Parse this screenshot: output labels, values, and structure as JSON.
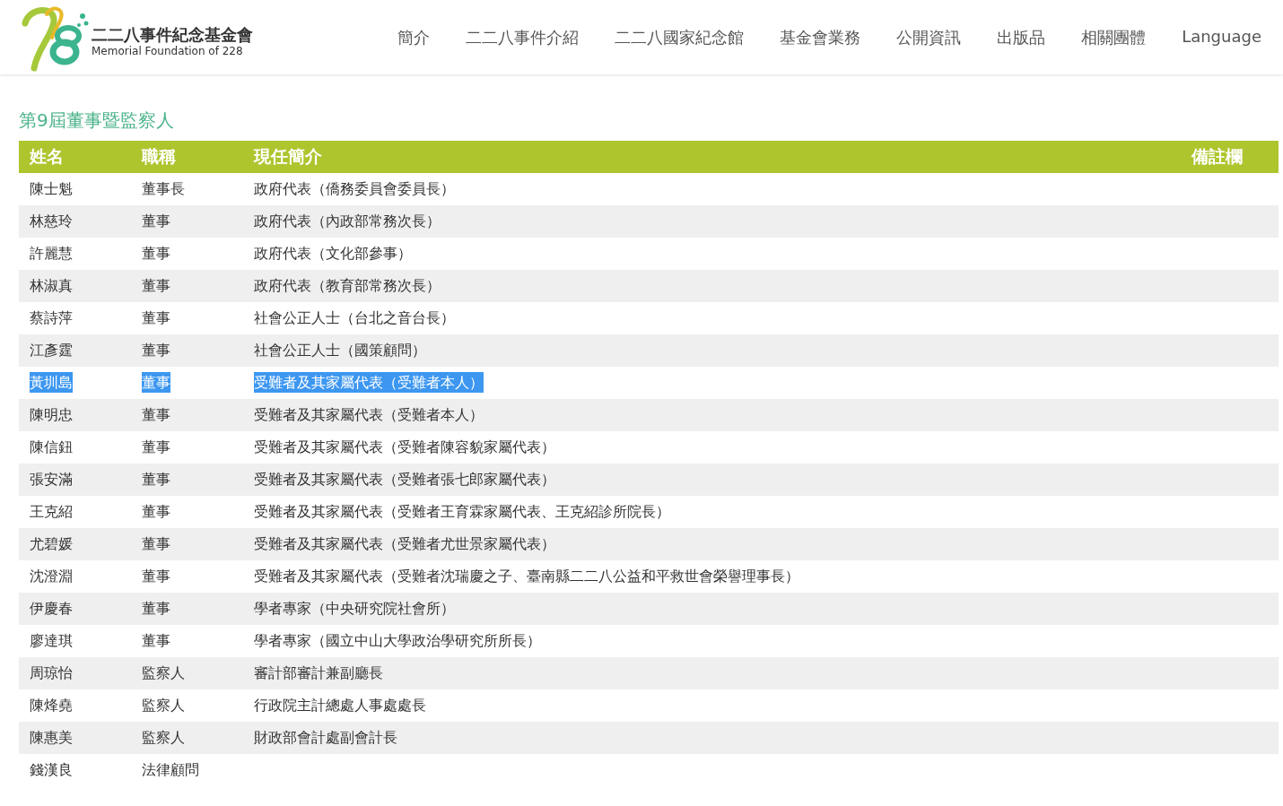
{
  "logo": {
    "title": "二二八事件紀念基金會",
    "subtitle": "Memorial Foundation of 228"
  },
  "nav": [
    "簡介",
    "二二八事件介紹",
    "二二八國家紀念館",
    "基金會業務",
    "公開資訊",
    "出版品",
    "相關團體",
    "Language"
  ],
  "page_title": "第9屆董事暨監察人",
  "table": {
    "columns": [
      "姓名",
      "職稱",
      "現任簡介",
      "備註欄"
    ],
    "rows": [
      {
        "name": "陳士魁",
        "title": "董事長",
        "bio": "政府代表（僑務委員會委員長）",
        "selected": false
      },
      {
        "name": "林慈玲",
        "title": "董事",
        "bio": "政府代表（內政部常務次長）",
        "selected": false
      },
      {
        "name": "許麗慧",
        "title": "董事",
        "bio": "政府代表（文化部參事）",
        "selected": false
      },
      {
        "name": "林淑真",
        "title": "董事",
        "bio": "政府代表（教育部常務次長）",
        "selected": false
      },
      {
        "name": "蔡詩萍",
        "title": "董事",
        "bio": "社會公正人士（台北之音台長）",
        "selected": false
      },
      {
        "name": "江彥霆",
        "title": "董事",
        "bio": "社會公正人士（國策顧問）",
        "selected": false
      },
      {
        "name": "黃圳島",
        "title": "董事",
        "bio": "受難者及其家屬代表（受難者本人）",
        "selected": true
      },
      {
        "name": "陳明忠",
        "title": "董事",
        "bio": "受難者及其家屬代表（受難者本人）",
        "selected": false
      },
      {
        "name": "陳信鈕",
        "title": "董事",
        "bio": "受難者及其家屬代表（受難者陳容貌家屬代表）",
        "selected": false
      },
      {
        "name": "張安滿",
        "title": "董事",
        "bio": "受難者及其家屬代表（受難者張七郎家屬代表）",
        "selected": false
      },
      {
        "name": "王克紹",
        "title": "董事",
        "bio": "受難者及其家屬代表（受難者王育霖家屬代表、王克紹診所院長）",
        "selected": false
      },
      {
        "name": "尤碧媛",
        "title": "董事",
        "bio": "受難者及其家屬代表（受難者尤世景家屬代表）",
        "selected": false
      },
      {
        "name": "沈澄淵",
        "title": "董事",
        "bio": "受難者及其家屬代表（受難者沈瑞慶之子、臺南縣二二八公益和平救世會榮譽理事長）",
        "selected": false
      },
      {
        "name": "伊慶春",
        "title": "董事",
        "bio": "學者專家（中央研究院社會所）",
        "selected": false
      },
      {
        "name": "廖達琪",
        "title": "董事",
        "bio": "學者專家（國立中山大學政治學研究所所長）",
        "selected": false
      },
      {
        "name": "周琼怡",
        "title": "監察人",
        "bio": "審計部審計兼副廳長",
        "selected": false
      },
      {
        "name": "陳烽堯",
        "title": "監察人",
        "bio": "行政院主計總處人事處處長",
        "selected": false
      },
      {
        "name": "陳惠美",
        "title": "監察人",
        "bio": "財政部會計處副會計長",
        "selected": false
      },
      {
        "name": "錢漢良",
        "title": "法律顧問",
        "selected": false
      }
    ]
  }
}
